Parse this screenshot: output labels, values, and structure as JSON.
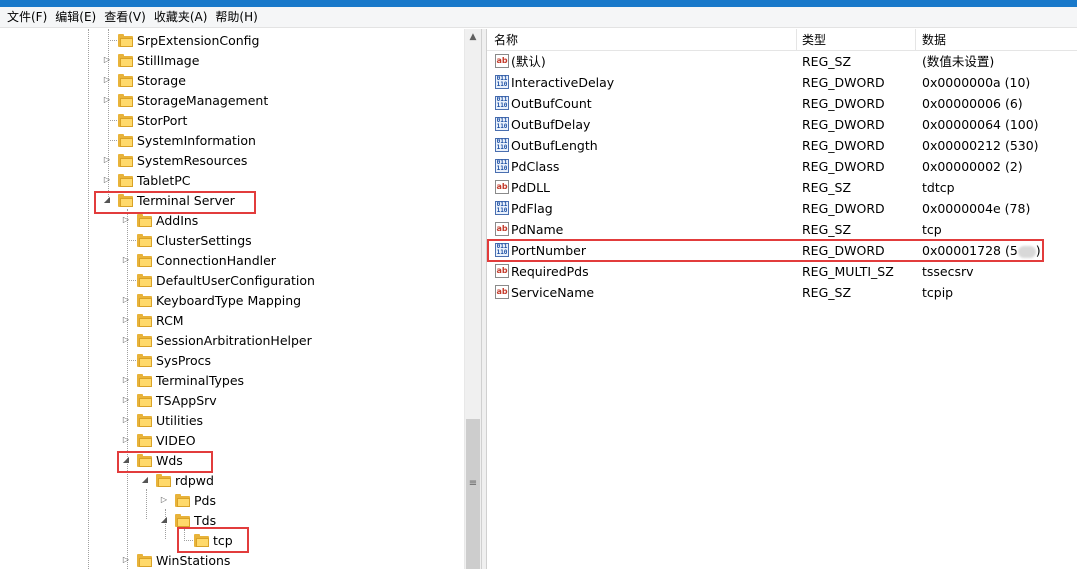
{
  "menu": [
    {
      "label": "文件(F)"
    },
    {
      "label": "编辑(E)"
    },
    {
      "label": "查看(V)"
    },
    {
      "label": "收藏夹(A)"
    },
    {
      "label": "帮助(H)"
    }
  ],
  "tree": [
    {
      "label": "SrpExtensionConfig",
      "expander": ""
    },
    {
      "label": "StillImage",
      "expander": "▷"
    },
    {
      "label": "Storage",
      "expander": "▷"
    },
    {
      "label": "StorageManagement",
      "expander": "▷"
    },
    {
      "label": "StorPort",
      "expander": ""
    },
    {
      "label": "SystemInformation",
      "expander": ""
    },
    {
      "label": "SystemResources",
      "expander": "▷"
    },
    {
      "label": "TabletPC",
      "expander": "▷"
    },
    {
      "label": "Terminal Server",
      "expander": "◢"
    },
    {
      "label": "AddIns",
      "expander": "▷"
    },
    {
      "label": "ClusterSettings",
      "expander": ""
    },
    {
      "label": "ConnectionHandler",
      "expander": "▷"
    },
    {
      "label": "DefaultUserConfiguration",
      "expander": ""
    },
    {
      "label": "KeyboardType Mapping",
      "expander": "▷"
    },
    {
      "label": "RCM",
      "expander": "▷"
    },
    {
      "label": "SessionArbitrationHelper",
      "expander": "▷"
    },
    {
      "label": "SysProcs",
      "expander": ""
    },
    {
      "label": "TerminalTypes",
      "expander": "▷"
    },
    {
      "label": "TSAppSrv",
      "expander": "▷"
    },
    {
      "label": "Utilities",
      "expander": "▷"
    },
    {
      "label": "VIDEO",
      "expander": "▷"
    },
    {
      "label": "Wds",
      "expander": "◢"
    },
    {
      "label": "rdpwd",
      "expander": "◢"
    },
    {
      "label": "Pds",
      "expander": "▷"
    },
    {
      "label": "Tds",
      "expander": "◢"
    },
    {
      "label": "tcp",
      "expander": ""
    },
    {
      "label": "WinStations",
      "expander": "▷"
    }
  ],
  "list": {
    "columns": [
      "名称",
      "类型",
      "数据"
    ],
    "rows": [
      {
        "icon": "ab",
        "name": "(默认)",
        "type": "REG_SZ",
        "data": "(数值未设置)"
      },
      {
        "icon": "bin",
        "name": "InteractiveDelay",
        "type": "REG_DWORD",
        "data": "0x0000000a (10)"
      },
      {
        "icon": "bin",
        "name": "OutBufCount",
        "type": "REG_DWORD",
        "data": "0x00000006 (6)"
      },
      {
        "icon": "bin",
        "name": "OutBufDelay",
        "type": "REG_DWORD",
        "data": "0x00000064 (100)"
      },
      {
        "icon": "bin",
        "name": "OutBufLength",
        "type": "REG_DWORD",
        "data": "0x00000212 (530)"
      },
      {
        "icon": "bin",
        "name": "PdClass",
        "type": "REG_DWORD",
        "data": "0x00000002 (2)"
      },
      {
        "icon": "ab",
        "name": "PdDLL",
        "type": "REG_SZ",
        "data": "tdtcp"
      },
      {
        "icon": "bin",
        "name": "PdFlag",
        "type": "REG_DWORD",
        "data": "0x0000004e (78)"
      },
      {
        "icon": "ab",
        "name": "PdName",
        "type": "REG_SZ",
        "data": "tcp"
      },
      {
        "icon": "bin",
        "name": "PortNumber",
        "type": "REG_DWORD",
        "data": "0x00001728 (5"
      },
      {
        "icon": "ab",
        "name": "RequiredPds",
        "type": "REG_MULTI_SZ",
        "data": "tssecsrv"
      },
      {
        "icon": "ab",
        "name": "ServiceName",
        "type": "REG_SZ",
        "data": "tcpip"
      }
    ],
    "port_suffix": ")"
  },
  "icons": {
    "string_value": "ab-string-icon",
    "binary_value": "dword-value-icon",
    "folder": "folder-icon"
  },
  "colors": {
    "highlight": "#e23c3c",
    "title_strip": "#1979ca",
    "folder": "#ffd96a"
  }
}
